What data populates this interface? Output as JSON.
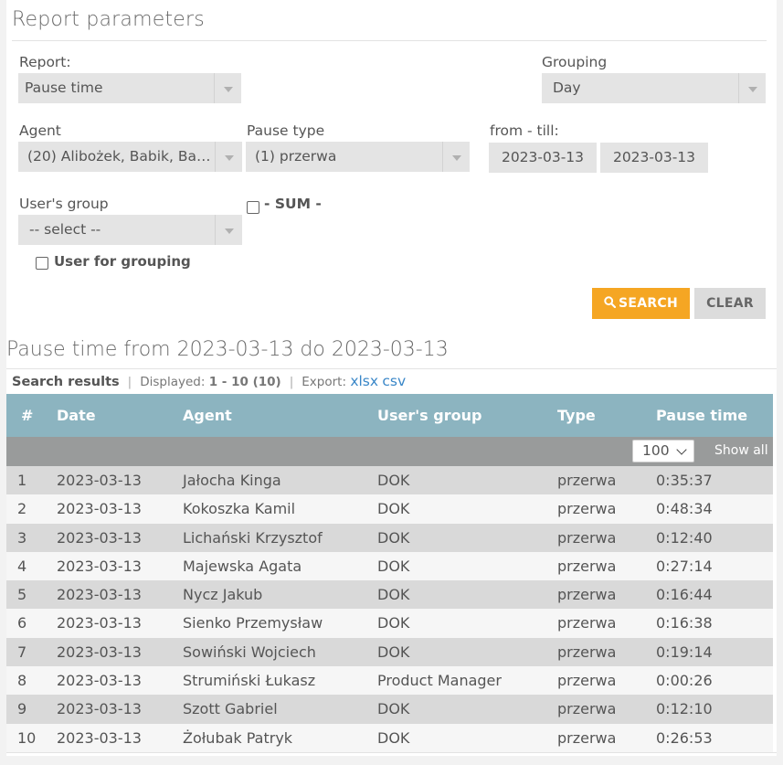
{
  "section_title": "Report parameters",
  "form": {
    "report": {
      "label": "Report:",
      "value": "Pause time"
    },
    "grouping": {
      "label": "Grouping",
      "value": "Day"
    },
    "agent": {
      "label": "Agent",
      "value": "(20) Alibożek, Babik, Bańk..."
    },
    "pause_type": {
      "label": "Pause type",
      "value": "(1) przerwa"
    },
    "from_till": {
      "label": "from - till:",
      "from": "2023-03-13",
      "till": "2023-03-13"
    },
    "users_group": {
      "label": "User's group",
      "value": "-- select --"
    },
    "sum": {
      "label": "- SUM -",
      "checked": false
    },
    "user_for_grouping": {
      "label": "User for grouping",
      "checked": false
    },
    "search_button": "SEARCH",
    "clear_button": "CLEAR"
  },
  "results": {
    "title": "Pause time from 2023-03-13 do 2023-03-13",
    "search_results_label": "Search results",
    "displayed_label": "Displayed:",
    "displayed_value": "1 - 10 (10)",
    "export_label": "Export:",
    "export_xlsx": "xlsx",
    "export_csv": "csv",
    "columns": [
      "#",
      "Date",
      "Agent",
      "User's group",
      "Type",
      "Pause time"
    ],
    "page_size": "100",
    "show_all": "Show all",
    "rows": [
      [
        "1",
        "2023-03-13",
        "Jałocha Kinga",
        "DOK",
        "przerwa",
        "0:35:37"
      ],
      [
        "2",
        "2023-03-13",
        "Kokoszka Kamil",
        "DOK",
        "przerwa",
        "0:48:34"
      ],
      [
        "3",
        "2023-03-13",
        "Lichański Krzysztof",
        "DOK",
        "przerwa",
        "0:12:40"
      ],
      [
        "4",
        "2023-03-13",
        "Majewska Agata",
        "DOK",
        "przerwa",
        "0:27:14"
      ],
      [
        "5",
        "2023-03-13",
        "Nycz Jakub",
        "DOK",
        "przerwa",
        "0:16:44"
      ],
      [
        "6",
        "2023-03-13",
        "Sienko Przemysław",
        "DOK",
        "przerwa",
        "0:16:38"
      ],
      [
        "7",
        "2023-03-13",
        "Sowiński Wojciech",
        "DOK",
        "przerwa",
        "0:19:14"
      ],
      [
        "8",
        "2023-03-13",
        "Strumiński Łukasz",
        "Product Manager",
        "przerwa",
        "0:00:26"
      ],
      [
        "9",
        "2023-03-13",
        "Szott Gabriel",
        "DOK",
        "przerwa",
        "0:12:10"
      ],
      [
        "10",
        "2023-03-13",
        "Żołubak Patryk",
        "DOK",
        "przerwa",
        "0:26:53"
      ]
    ]
  },
  "colors": {
    "accent": "#f5a623",
    "table_header": "#8cb4c0",
    "pager_bar": "#999b9b",
    "link": "#3a87c8"
  }
}
